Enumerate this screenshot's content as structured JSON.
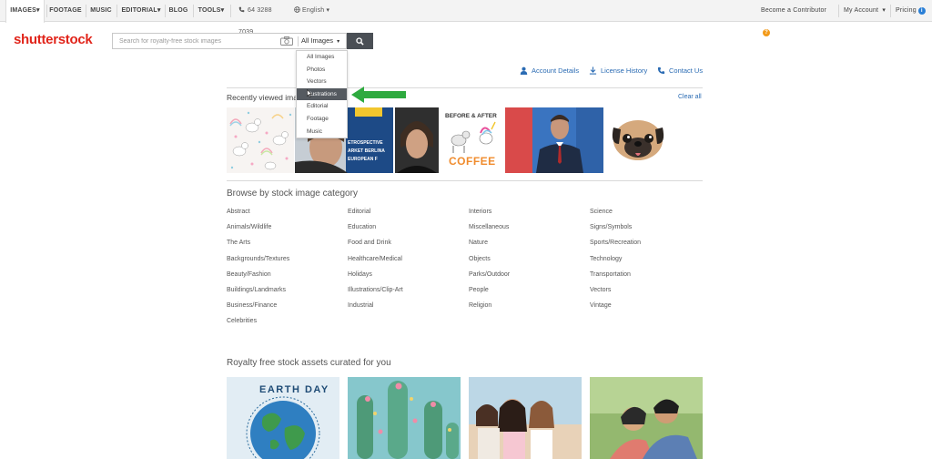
{
  "topnav": {
    "images": "IMAGES▾",
    "footage": "FOOTAGE",
    "music": "MUSIC",
    "editorial": "EDITORIAL▾",
    "blog": "BLOG",
    "tools": "TOOLS▾",
    "phone": "64 3288 7039",
    "language": "English ▾",
    "contributor": "Become a Contributor",
    "my_account": "My Account",
    "my_account_caret": "▾",
    "pricing": "Pricing"
  },
  "logo": "shutterstock",
  "search": {
    "placeholder": "Search for royalty-free stock images",
    "type_selected": "All Images",
    "type_caret": "▾"
  },
  "dropdown": {
    "options": [
      "All Images",
      "Photos",
      "Vectors",
      "Illustrations",
      "Editorial",
      "Footage",
      "Music"
    ],
    "highlighted": "Illustrations"
  },
  "account_links": {
    "details": "Account Details",
    "license": "License History",
    "contact": "Contact Us"
  },
  "recent": {
    "heading": "Recently viewed images",
    "clear": "Clear all",
    "thumb_texts": {
      "retro": [
        "ETROSPECTIVE",
        "ARKET BERLINA",
        "EUROPEAN F"
      ],
      "coffee_top": "BEFORE & AFTER",
      "coffee_bottom": "COFFEE"
    }
  },
  "browse": {
    "heading": "Browse by stock image category",
    "columns": [
      [
        "Abstract",
        "Animals/Wildlife",
        "The Arts",
        "Backgrounds/Textures",
        "Beauty/Fashion",
        "Buildings/Landmarks",
        "Business/Finance",
        "Celebrities"
      ],
      [
        "Editorial",
        "Education",
        "Food and Drink",
        "Healthcare/Medical",
        "Holidays",
        "Illustrations/Clip-Art",
        "Industrial"
      ],
      [
        "Interiors",
        "Miscellaneous",
        "Nature",
        "Objects",
        "Parks/Outdoor",
        "People",
        "Religion"
      ],
      [
        "Science",
        "Signs/Symbols",
        "Sports/Recreation",
        "Technology",
        "Transportation",
        "Vectors",
        "Vintage"
      ]
    ]
  },
  "curated": {
    "heading": "Royalty free stock assets curated for you",
    "earth_day": "EARTH DAY"
  },
  "colors": {
    "brand_red": "#e1251b",
    "link_blue": "#2a6bb3",
    "arrow_green": "#2eaa3f"
  }
}
